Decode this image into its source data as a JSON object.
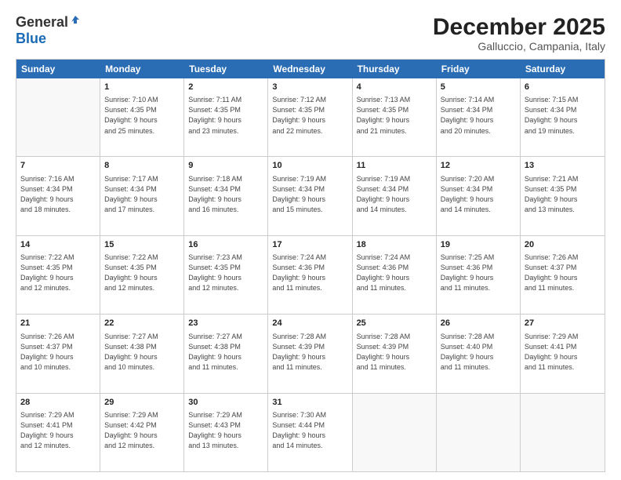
{
  "logo": {
    "general": "General",
    "blue": "Blue"
  },
  "header": {
    "month": "December 2025",
    "location": "Galluccio, Campania, Italy"
  },
  "weekdays": [
    "Sunday",
    "Monday",
    "Tuesday",
    "Wednesday",
    "Thursday",
    "Friday",
    "Saturday"
  ],
  "weeks": [
    [
      {
        "day": "",
        "info": ""
      },
      {
        "day": "1",
        "info": "Sunrise: 7:10 AM\nSunset: 4:35 PM\nDaylight: 9 hours\nand 25 minutes."
      },
      {
        "day": "2",
        "info": "Sunrise: 7:11 AM\nSunset: 4:35 PM\nDaylight: 9 hours\nand 23 minutes."
      },
      {
        "day": "3",
        "info": "Sunrise: 7:12 AM\nSunset: 4:35 PM\nDaylight: 9 hours\nand 22 minutes."
      },
      {
        "day": "4",
        "info": "Sunrise: 7:13 AM\nSunset: 4:35 PM\nDaylight: 9 hours\nand 21 minutes."
      },
      {
        "day": "5",
        "info": "Sunrise: 7:14 AM\nSunset: 4:34 PM\nDaylight: 9 hours\nand 20 minutes."
      },
      {
        "day": "6",
        "info": "Sunrise: 7:15 AM\nSunset: 4:34 PM\nDaylight: 9 hours\nand 19 minutes."
      }
    ],
    [
      {
        "day": "7",
        "info": "Sunrise: 7:16 AM\nSunset: 4:34 PM\nDaylight: 9 hours\nand 18 minutes."
      },
      {
        "day": "8",
        "info": "Sunrise: 7:17 AM\nSunset: 4:34 PM\nDaylight: 9 hours\nand 17 minutes."
      },
      {
        "day": "9",
        "info": "Sunrise: 7:18 AM\nSunset: 4:34 PM\nDaylight: 9 hours\nand 16 minutes."
      },
      {
        "day": "10",
        "info": "Sunrise: 7:19 AM\nSunset: 4:34 PM\nDaylight: 9 hours\nand 15 minutes."
      },
      {
        "day": "11",
        "info": "Sunrise: 7:19 AM\nSunset: 4:34 PM\nDaylight: 9 hours\nand 14 minutes."
      },
      {
        "day": "12",
        "info": "Sunrise: 7:20 AM\nSunset: 4:34 PM\nDaylight: 9 hours\nand 14 minutes."
      },
      {
        "day": "13",
        "info": "Sunrise: 7:21 AM\nSunset: 4:35 PM\nDaylight: 9 hours\nand 13 minutes."
      }
    ],
    [
      {
        "day": "14",
        "info": "Sunrise: 7:22 AM\nSunset: 4:35 PM\nDaylight: 9 hours\nand 12 minutes."
      },
      {
        "day": "15",
        "info": "Sunrise: 7:22 AM\nSunset: 4:35 PM\nDaylight: 9 hours\nand 12 minutes."
      },
      {
        "day": "16",
        "info": "Sunrise: 7:23 AM\nSunset: 4:35 PM\nDaylight: 9 hours\nand 12 minutes."
      },
      {
        "day": "17",
        "info": "Sunrise: 7:24 AM\nSunset: 4:36 PM\nDaylight: 9 hours\nand 11 minutes."
      },
      {
        "day": "18",
        "info": "Sunrise: 7:24 AM\nSunset: 4:36 PM\nDaylight: 9 hours\nand 11 minutes."
      },
      {
        "day": "19",
        "info": "Sunrise: 7:25 AM\nSunset: 4:36 PM\nDaylight: 9 hours\nand 11 minutes."
      },
      {
        "day": "20",
        "info": "Sunrise: 7:26 AM\nSunset: 4:37 PM\nDaylight: 9 hours\nand 11 minutes."
      }
    ],
    [
      {
        "day": "21",
        "info": "Sunrise: 7:26 AM\nSunset: 4:37 PM\nDaylight: 9 hours\nand 10 minutes."
      },
      {
        "day": "22",
        "info": "Sunrise: 7:27 AM\nSunset: 4:38 PM\nDaylight: 9 hours\nand 10 minutes."
      },
      {
        "day": "23",
        "info": "Sunrise: 7:27 AM\nSunset: 4:38 PM\nDaylight: 9 hours\nand 11 minutes."
      },
      {
        "day": "24",
        "info": "Sunrise: 7:28 AM\nSunset: 4:39 PM\nDaylight: 9 hours\nand 11 minutes."
      },
      {
        "day": "25",
        "info": "Sunrise: 7:28 AM\nSunset: 4:39 PM\nDaylight: 9 hours\nand 11 minutes."
      },
      {
        "day": "26",
        "info": "Sunrise: 7:28 AM\nSunset: 4:40 PM\nDaylight: 9 hours\nand 11 minutes."
      },
      {
        "day": "27",
        "info": "Sunrise: 7:29 AM\nSunset: 4:41 PM\nDaylight: 9 hours\nand 11 minutes."
      }
    ],
    [
      {
        "day": "28",
        "info": "Sunrise: 7:29 AM\nSunset: 4:41 PM\nDaylight: 9 hours\nand 12 minutes."
      },
      {
        "day": "29",
        "info": "Sunrise: 7:29 AM\nSunset: 4:42 PM\nDaylight: 9 hours\nand 12 minutes."
      },
      {
        "day": "30",
        "info": "Sunrise: 7:29 AM\nSunset: 4:43 PM\nDaylight: 9 hours\nand 13 minutes."
      },
      {
        "day": "31",
        "info": "Sunrise: 7:30 AM\nSunset: 4:44 PM\nDaylight: 9 hours\nand 14 minutes."
      },
      {
        "day": "",
        "info": ""
      },
      {
        "day": "",
        "info": ""
      },
      {
        "day": "",
        "info": ""
      }
    ]
  ]
}
